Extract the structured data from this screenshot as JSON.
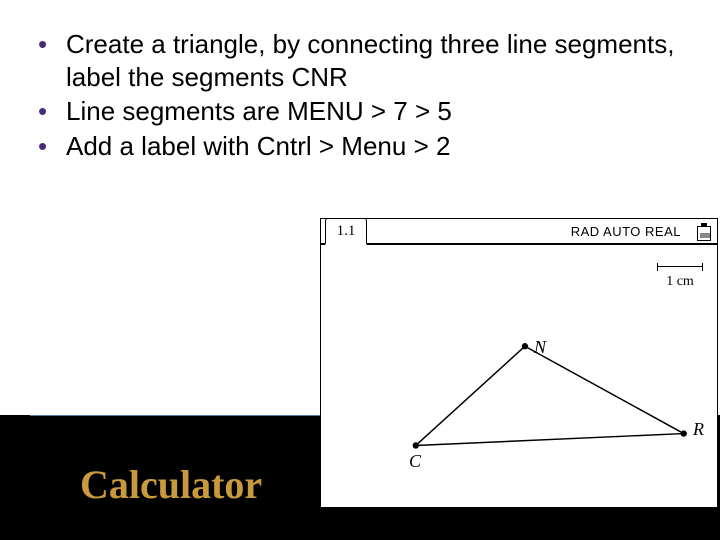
{
  "bullets": {
    "b1": "Create a triangle, by connecting three line segments, label the segments CNR",
    "b2": "Line segments are MENU > 7 > 5",
    "b3": "Add a label with Cntrl > Menu > 2"
  },
  "footer": {
    "title": "Calculator"
  },
  "calc": {
    "tab": "1.1",
    "status": "RAD AUTO REAL",
    "scale": "1 cm",
    "labels": {
      "N": "N",
      "C": "C",
      "R": "R"
    }
  }
}
